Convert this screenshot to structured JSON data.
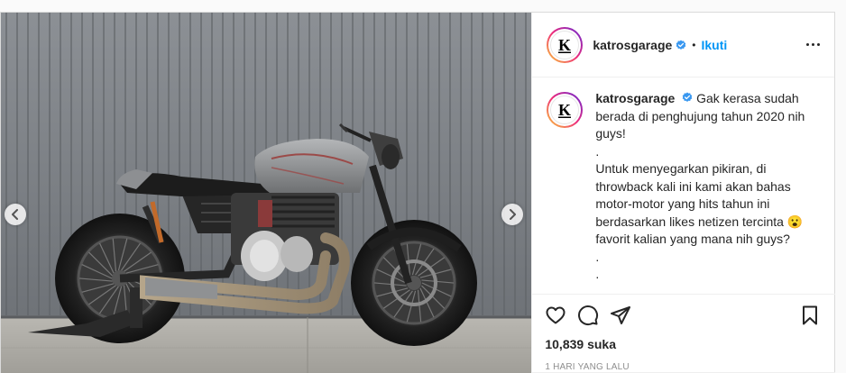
{
  "post": {
    "username": "katrosgarage",
    "follow_label": "Ikuti",
    "dot": "•",
    "avatar_letter": "K",
    "verified_color": "#3897f0",
    "caption_lines": [
      "Gak kerasa sudah",
      "berada di penghujung tahun 2020 nih",
      "guys!",
      ".",
      "Untuk menyegarkan pikiran, di",
      "throwback kali ini kami akan bahas",
      "motor-motor yang hits tahun ini",
      "berdasarkan likes netizen tercinta 😮",
      "favorit kalian yang mana nih guys?",
      ".",
      "."
    ],
    "likes": "10,839 suka",
    "time_ago": "1 HARI YANG LALU"
  },
  "icons": {
    "like": "heart-icon",
    "comment": "comment-icon",
    "share": "paper-plane-icon",
    "save": "bookmark-icon",
    "options": "more-options-icon",
    "prev": "chevron-left-icon",
    "next": "chevron-right-icon"
  },
  "colors": {
    "accent": "#0095f6",
    "text": "#262626",
    "muted": "#8e8e8e"
  }
}
